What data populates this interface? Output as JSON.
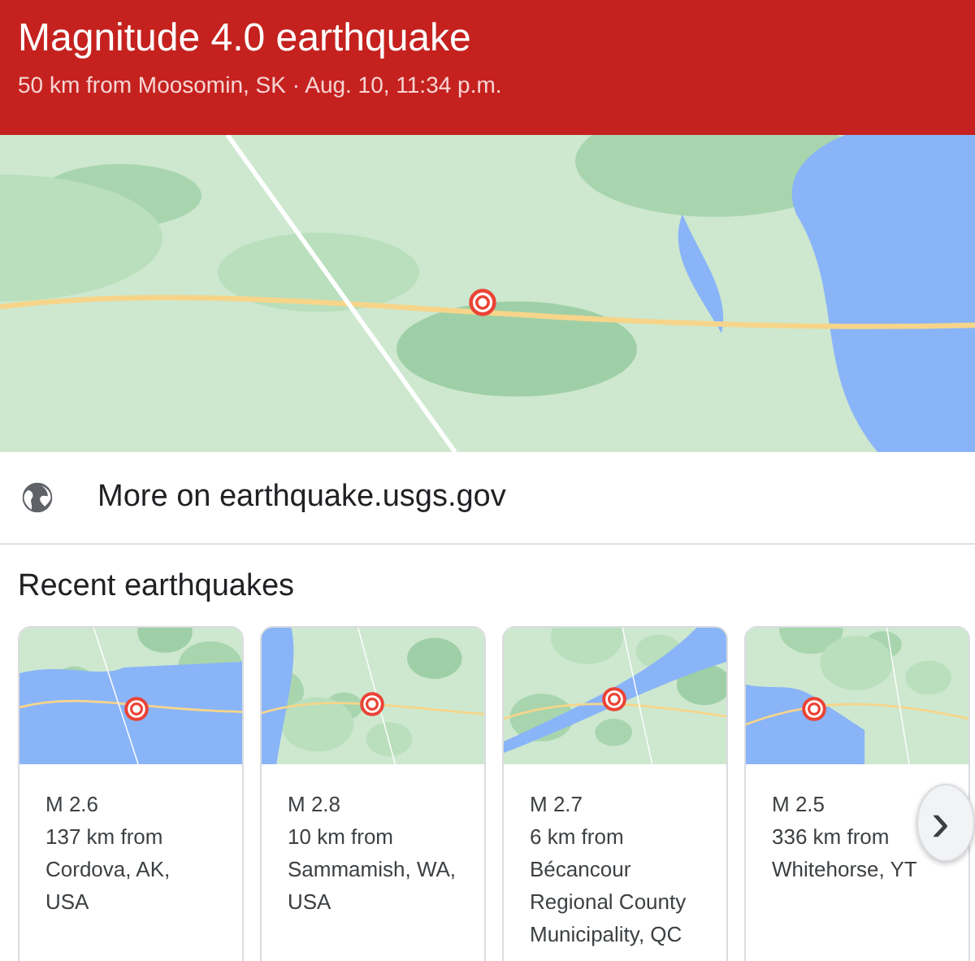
{
  "header": {
    "title": "Magnitude 4.0 earthquake",
    "subtitle": "50 km from Moosomin, SK · Aug. 10, 11:34 p.m."
  },
  "source_link": {
    "label": "More on earthquake.usgs.gov"
  },
  "recent": {
    "heading": "Recent earthquakes",
    "cards": [
      {
        "magnitude": "M 2.6",
        "lines": [
          "137 km from",
          "Cordova, AK,",
          "USA"
        ]
      },
      {
        "magnitude": "M 2.8",
        "lines": [
          "10 km from",
          "Sammamish, WA,",
          "USA"
        ]
      },
      {
        "magnitude": "M 2.7",
        "lines": [
          "6 km from",
          "Bécancour",
          "Regional County",
          "Municipality, QC"
        ]
      },
      {
        "magnitude": "M 2.5",
        "lines": [
          "336 km from",
          "Whitehorse, YT"
        ]
      }
    ],
    "next_button": {
      "label": "›"
    }
  }
}
